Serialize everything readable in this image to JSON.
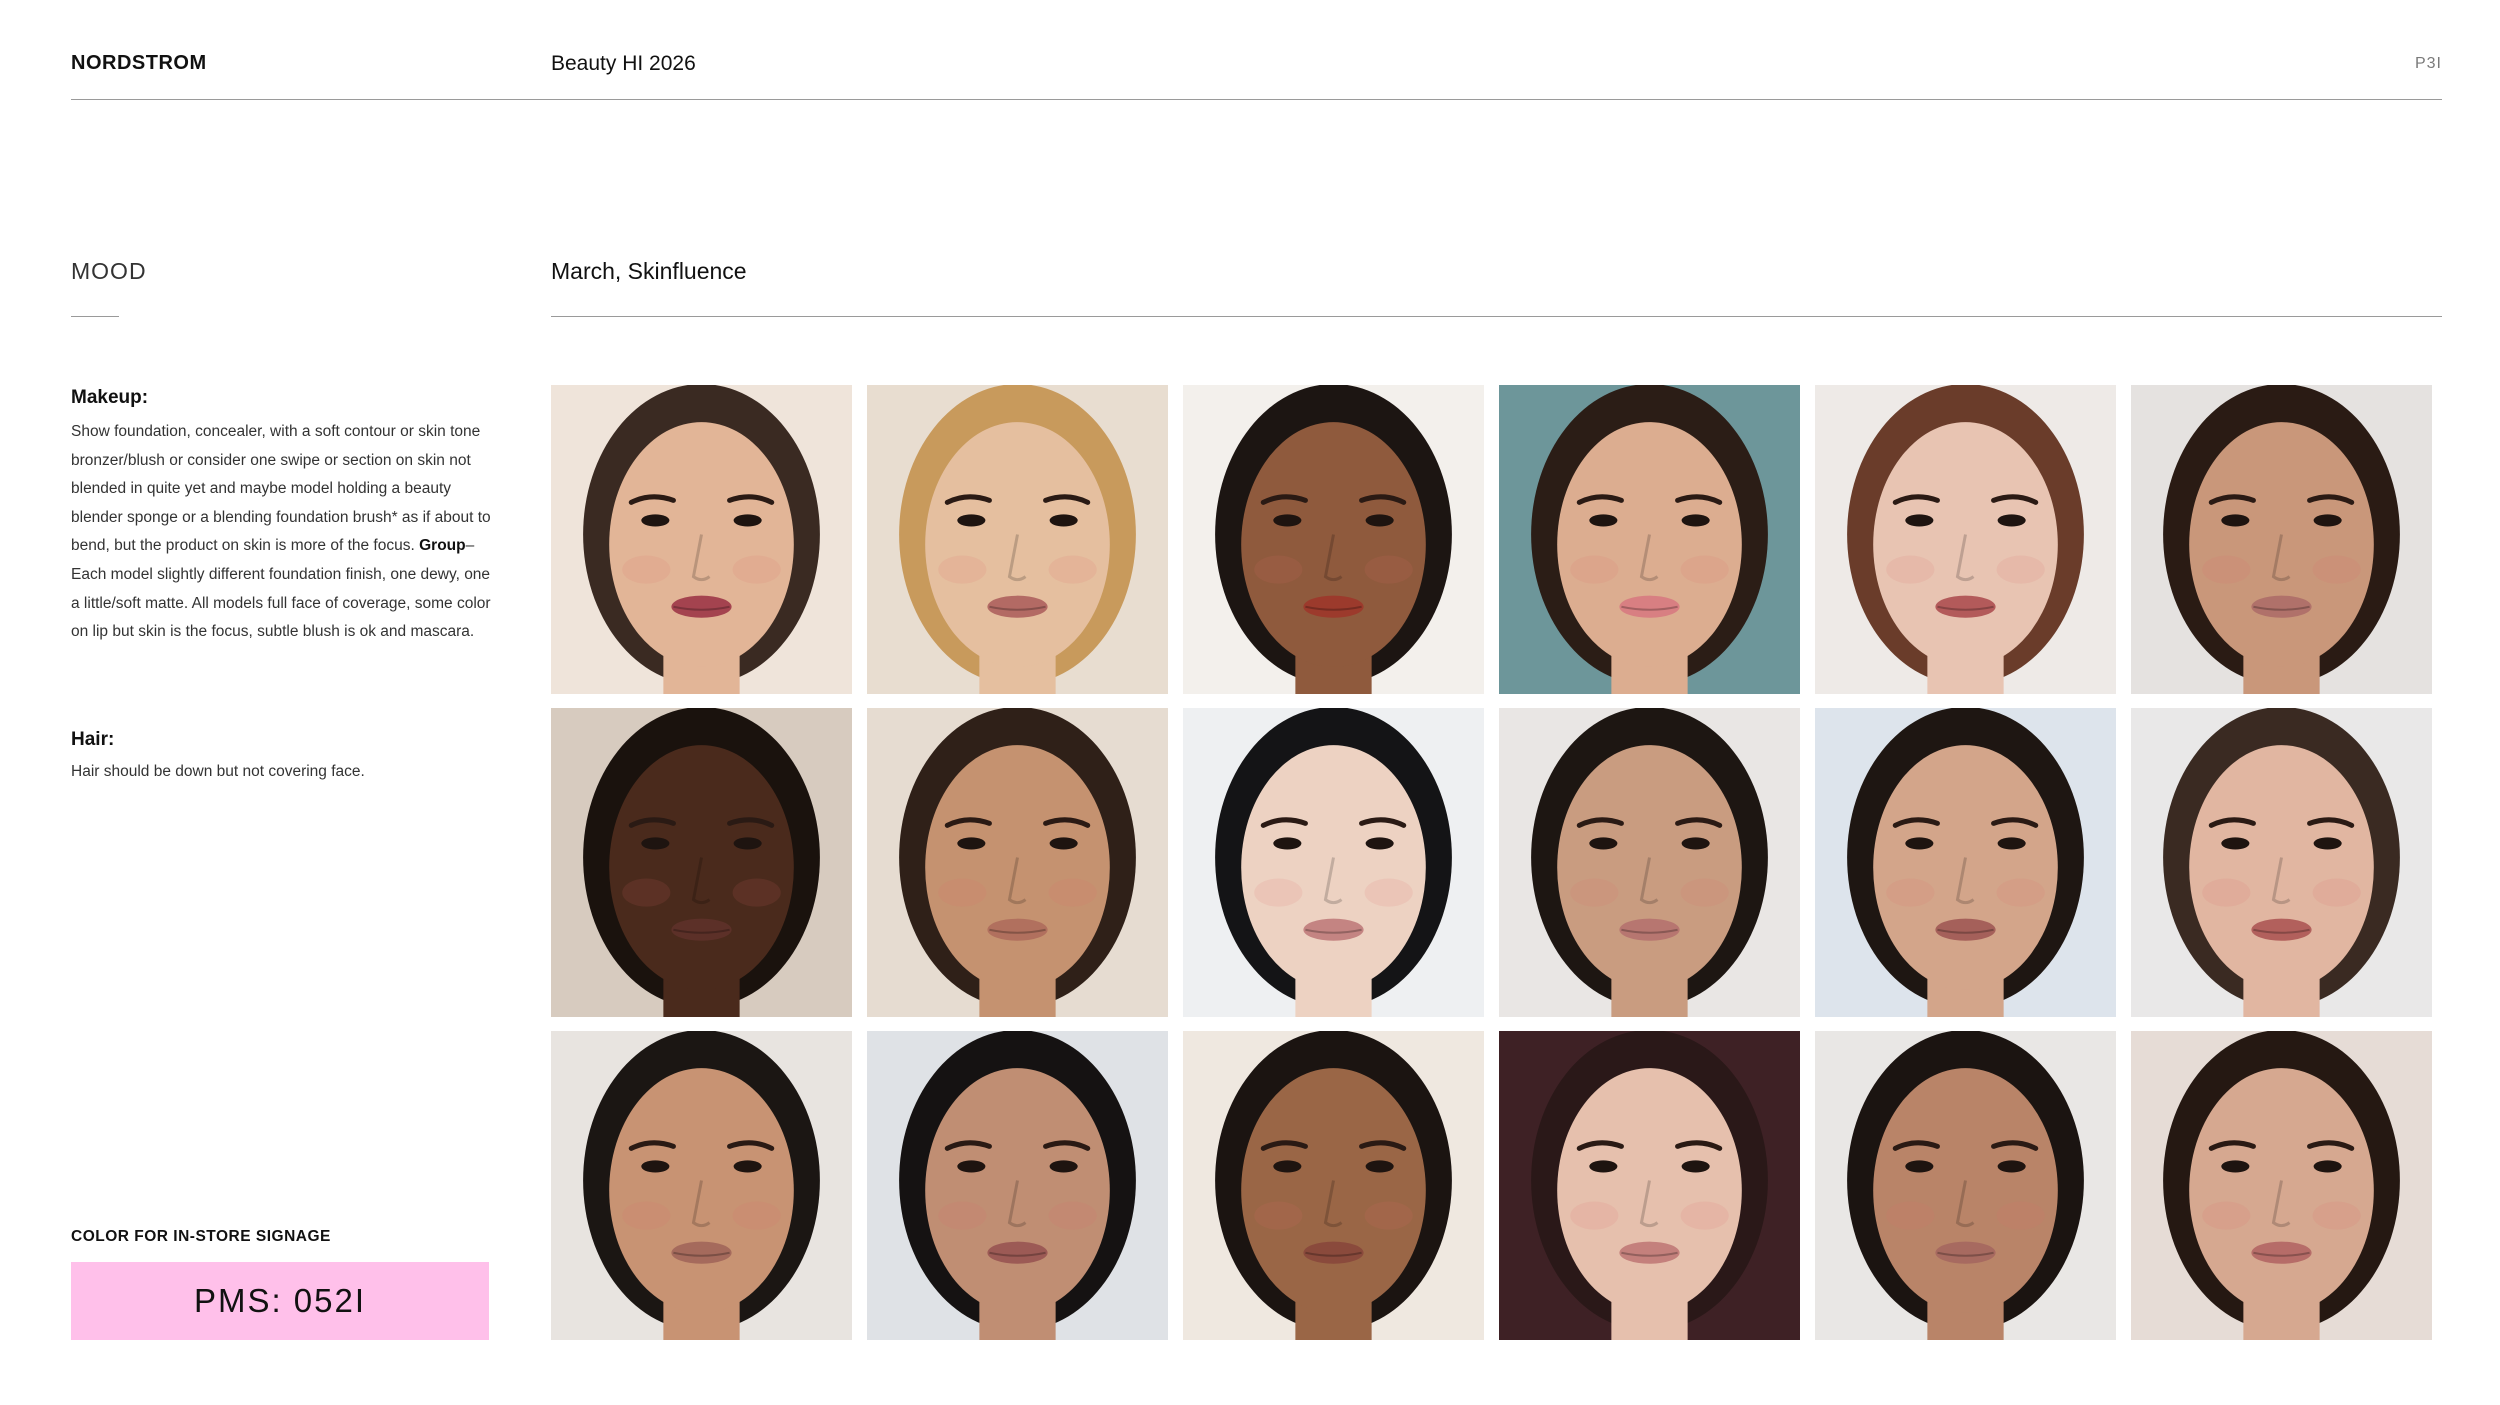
{
  "header": {
    "brand": "NORDSTROM",
    "title": "Beauty HI 2026",
    "page": "P3I"
  },
  "section": {
    "label": "MOOD",
    "subtitle": "March, Skinfluence"
  },
  "makeup": {
    "heading": "Makeup:",
    "text_part1": "Show foundation, concealer, with a soft contour or skin tone bronzer/blush or consider one swipe or section on skin not blended in quite yet and maybe model holding a beauty blender sponge or a blending foundation brush* as if about to bend, but the product on skin is more of the focus.",
    "group_label": "Group",
    "text_part2": "–Each model slightly different foundation finish, one dewy, one a little/soft matte. All models full face of coverage, some color on lip but skin is the focus, subtle blush is ok and mascara."
  },
  "hair": {
    "heading": "Hair:",
    "text": "Hair should be down but not covering face."
  },
  "signage": {
    "label": "COLOR FOR IN-STORE SIGNAGE",
    "pms": "PMS: 052I",
    "swatch_color": "#ffc0ea"
  },
  "photos": [
    {
      "name": "photo-model-blush-brush",
      "bg": "#efe4da",
      "skin": "#e2b597",
      "hair": "#3a2a22",
      "lip": "#a4434f"
    },
    {
      "name": "photo-group-three-models",
      "bg": "#e8ddd0",
      "skin": "#e5bf9f",
      "hair": "#c89a5c",
      "lip": "#b36a64"
    },
    {
      "name": "photo-model-pout-closeup",
      "bg": "#f3f0ec",
      "skin": "#8f5a3d",
      "hair": "#1c1512",
      "lip": "#9c3a2c"
    },
    {
      "name": "photo-model-teal-backdrop",
      "bg": "#6d969a",
      "skin": "#dcad90",
      "hair": "#2b1d16",
      "lip": "#d87f82"
    },
    {
      "name": "photo-model-slick-hair",
      "bg": "#eeeae7",
      "skin": "#e8c4b2",
      "hair": "#6a3c2a",
      "lip": "#b35a5a"
    },
    {
      "name": "photo-group-four-models",
      "bg": "#e5e2e0",
      "skin": "#c9977a",
      "hair": "#2a1b14",
      "lip": "#b0716a"
    },
    {
      "name": "photo-model-deep-skin-closeup",
      "bg": "#d7cbbf",
      "skin": "#4a2a1c",
      "hair": "#1a120d",
      "lip": "#5c3028"
    },
    {
      "name": "photo-model-hand-on-cheek",
      "bg": "#e6dcd1",
      "skin": "#c59270",
      "hair": "#2f2018",
      "lip": "#b1705e"
    },
    {
      "name": "photo-model-dark-bob",
      "bg": "#eef0f2",
      "skin": "#edd2c2",
      "hair": "#141416",
      "lip": "#c48482"
    },
    {
      "name": "photo-group-three-faces",
      "bg": "#e9e6e4",
      "skin": "#c99c80",
      "hair": "#1d1612",
      "lip": "#b77670"
    },
    {
      "name": "photo-model-holding-foundation",
      "bg": "#dde4ec",
      "skin": "#d3a58a",
      "hair": "#1e1612",
      "lip": "#a5605a"
    },
    {
      "name": "photo-model-turtleneck",
      "bg": "#e9e8e8",
      "skin": "#e1b6a1",
      "hair": "#3a2a22",
      "lip": "#b2605c"
    },
    {
      "name": "photo-model-windswept-hair",
      "bg": "#e8e4e0",
      "skin": "#c89373",
      "hair": "#1b1613",
      "lip": "#a56a5c"
    },
    {
      "name": "photo-group-four-black-outfits",
      "bg": "#dfe2e6",
      "skin": "#c08e73",
      "hair": "#151212",
      "lip": "#9c5a55"
    },
    {
      "name": "photo-model-curly-hair",
      "bg": "#efe8e0",
      "skin": "#9a6646",
      "hair": "#1b1411",
      "lip": "#8a4a3c"
    },
    {
      "name": "photo-model-dark-backdrop",
      "bg": "#3e2125",
      "skin": "#e6c0ad",
      "hair": "#2a1818",
      "lip": "#c4807c"
    },
    {
      "name": "photo-two-models-cheek",
      "bg": "#e9e7e5",
      "skin": "#b98468",
      "hair": "#1b1411",
      "lip": "#a76a60"
    },
    {
      "name": "photo-three-models-close",
      "bg": "#e6dcd6",
      "skin": "#d6a890",
      "hair": "#251812",
      "lip": "#b66c68"
    }
  ]
}
